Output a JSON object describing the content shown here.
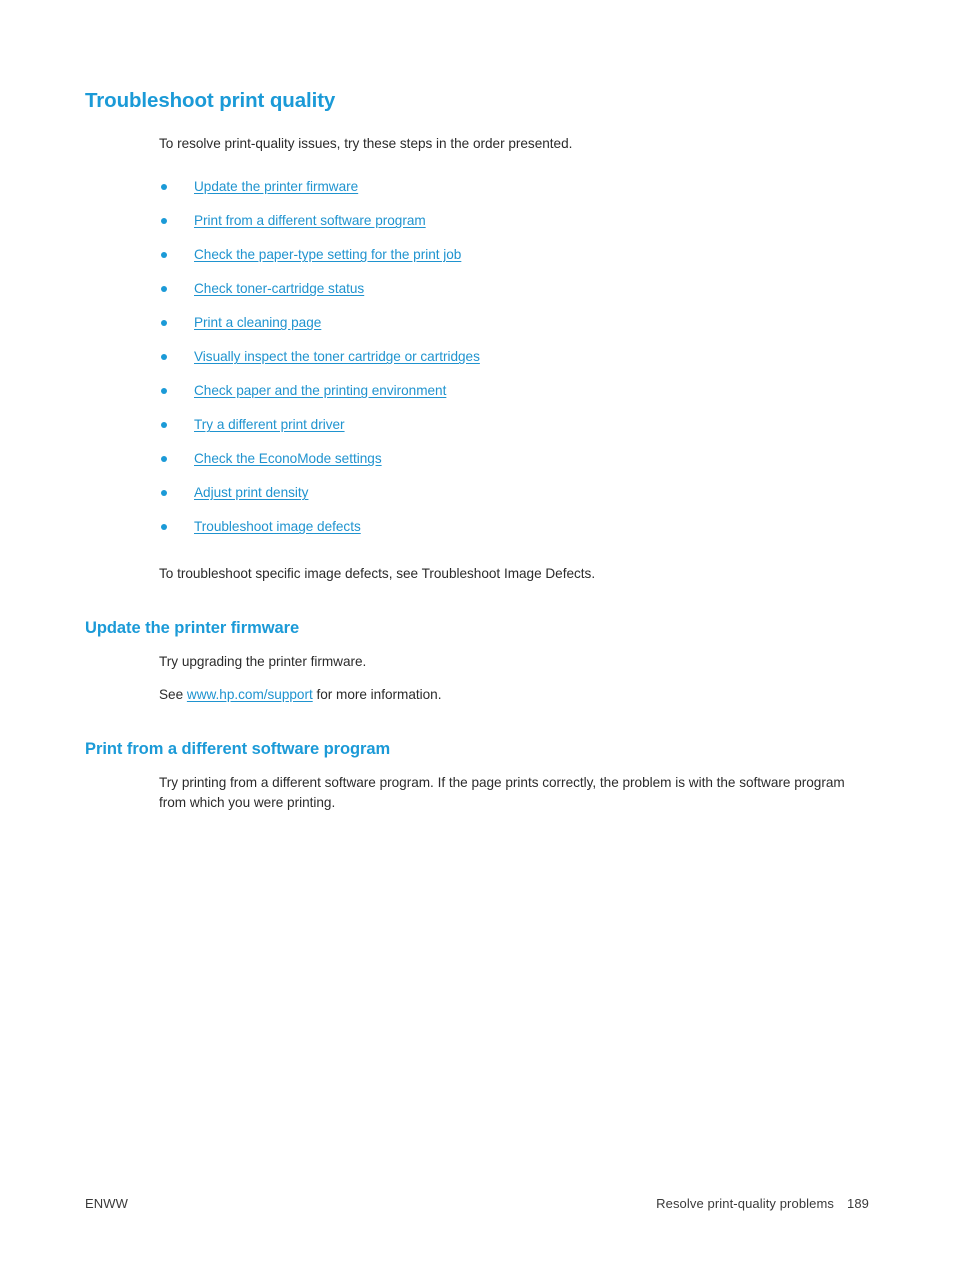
{
  "document": {
    "main_heading": "Troubleshoot print quality",
    "intro_text": "To resolve print-quality issues, try these steps in the order presented.",
    "link_list": [
      {
        "label": "Update the printer firmware"
      },
      {
        "label": "Print from a different software program"
      },
      {
        "label": "Check the paper-type setting for the print job"
      },
      {
        "label": "Check toner-cartridge status"
      },
      {
        "label": "Print a cleaning page"
      },
      {
        "label": "Visually inspect the toner cartridge or cartridges"
      },
      {
        "label": "Check paper and the printing environment"
      },
      {
        "label": "Try a different print driver"
      },
      {
        "label": "Check the EconoMode settings"
      },
      {
        "label": "Adjust print density"
      },
      {
        "label": "Troubleshoot image defects"
      }
    ],
    "after_list_text": "To troubleshoot specific image defects, see Troubleshoot Image Defects.",
    "sections": [
      {
        "heading": "Update the printer firmware",
        "paragraph_1": "Try upgrading the printer firmware.",
        "see_prefix": "See ",
        "see_link": "www.hp.com/support",
        "see_suffix": " for more information."
      },
      {
        "heading": "Print from a different software program",
        "paragraph_1": "Try printing from a different software program. If the page prints correctly, the problem is with the software program from which you were printing."
      }
    ]
  },
  "footer": {
    "left_label": "ENWW",
    "right_label": "Resolve print-quality problems",
    "page_number": "189"
  },
  "colors": {
    "heading_blue": "#1b9ad7",
    "link_blue": "#1f93cf",
    "body_text": "#2b2b2b",
    "page_background": "#ffffff"
  }
}
